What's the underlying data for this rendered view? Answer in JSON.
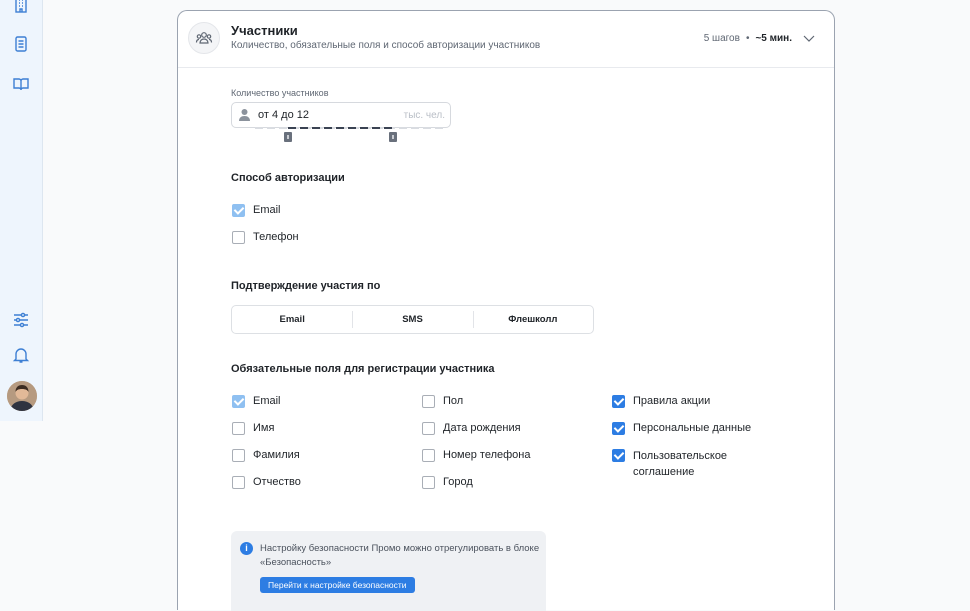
{
  "colors": {
    "accent": "#2d7de3",
    "sidebar_bg": "#eef5fd"
  },
  "sidebar": {
    "icons": [
      "building-icon",
      "notebook-icon",
      "book-icon",
      "sliders-icon",
      "bell-icon"
    ]
  },
  "section": {
    "title": "Участники",
    "subtitle": "Количество, обязательные поля и способ авторизации участников",
    "steps": "5 шагов",
    "separator": "•",
    "time": "~5 мин."
  },
  "count": {
    "label": "Количество участников",
    "value": "от 4 до 12",
    "unit": "тыс. чел."
  },
  "auth": {
    "title": "Способ авторизации",
    "options": [
      {
        "label": "Email",
        "checked": true
      },
      {
        "label": "Телефон",
        "checked": false
      }
    ]
  },
  "confirm": {
    "title": "Подтверждение участия по",
    "options": [
      "Email",
      "SMS",
      "Флешколл"
    ]
  },
  "required": {
    "title": "Обязательные поля для регистрации участника",
    "col1": [
      {
        "label": "Email",
        "checked": true
      },
      {
        "label": "Имя",
        "checked": false
      },
      {
        "label": "Фамилия",
        "checked": false
      },
      {
        "label": "Отчество",
        "checked": false
      }
    ],
    "col2": [
      {
        "label": "Пол",
        "checked": false
      },
      {
        "label": "Дата рождения",
        "checked": false
      },
      {
        "label": "Номер телефона",
        "checked": false
      },
      {
        "label": "Город",
        "checked": false
      }
    ],
    "col3": [
      {
        "label": "Правила акции",
        "checked": true
      },
      {
        "label": "Персональные данные",
        "checked": true
      },
      {
        "label": "Пользовательское соглашение",
        "checked": true
      }
    ]
  },
  "info": {
    "icon": "i",
    "text": "Настройку безопасности Промо можно отрегулировать в блоке «Безопасность»",
    "button": "Перейти к настройке безопасности"
  }
}
